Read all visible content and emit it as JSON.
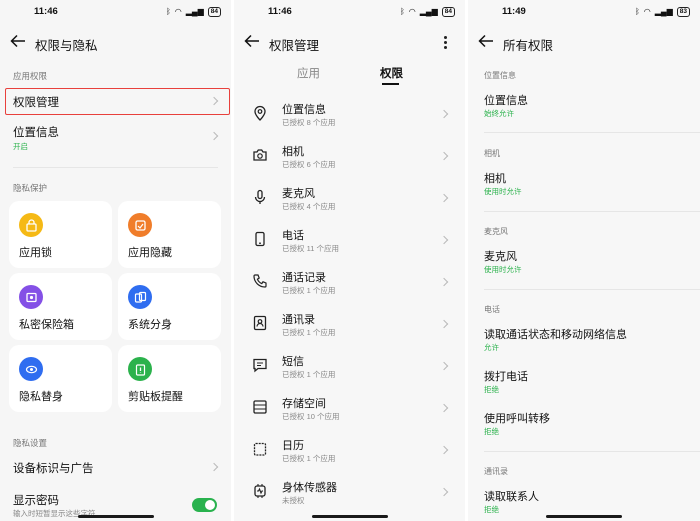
{
  "colors": {
    "accent_green": "#29b24e",
    "highlight_red": "#e8403c",
    "status_on": "#2bb24c"
  },
  "panel1": {
    "time": "11:46",
    "battery": "84",
    "title": "权限与隐私",
    "sec_app": "应用权限",
    "perm_mgmt": "权限管理",
    "location": "位置信息",
    "location_status": "开启",
    "sec_privacy": "隐私保护",
    "cards": [
      {
        "label": "应用锁",
        "icon": "app-lock-icon",
        "color": "#f5b915"
      },
      {
        "label": "应用隐藏",
        "icon": "app-hide-icon",
        "color": "#f07d2a"
      },
      {
        "label": "私密保险箱",
        "icon": "private-safe-icon",
        "color": "#8450e6"
      },
      {
        "label": "系统分身",
        "icon": "system-clone-icon",
        "color": "#2f6df0"
      },
      {
        "label": "隐私替身",
        "icon": "privacy-standin-icon",
        "color": "#2f6df0"
      },
      {
        "label": "剪贴板提醒",
        "icon": "clipboard-alert-icon",
        "color": "#2bb24c"
      }
    ],
    "sec_settings": "隐私设置",
    "device_id": "设备标识与广告",
    "show_password": "显示密码",
    "show_password_sub": "输入时短暂显示这些字符"
  },
  "panel2": {
    "time": "11:46",
    "battery": "84",
    "title": "权限管理",
    "tab_apps": "应用",
    "tab_perms": "权限",
    "items": [
      {
        "title": "位置信息",
        "sub": "已授权 8 个应用",
        "icon": "location-pin-icon"
      },
      {
        "title": "相机",
        "sub": "已授权 6 个应用",
        "icon": "camera-icon"
      },
      {
        "title": "麦克风",
        "sub": "已授权 4 个应用",
        "icon": "microphone-icon"
      },
      {
        "title": "电话",
        "sub": "已授权 11 个应用",
        "icon": "phone-device-icon"
      },
      {
        "title": "通话记录",
        "sub": "已授权 1 个应用",
        "icon": "call-log-icon"
      },
      {
        "title": "通讯录",
        "sub": "已授权 1 个应用",
        "icon": "contacts-icon"
      },
      {
        "title": "短信",
        "sub": "已授权 1 个应用",
        "icon": "sms-icon"
      },
      {
        "title": "存储空间",
        "sub": "已授权 10 个应用",
        "icon": "storage-icon"
      },
      {
        "title": "日历",
        "sub": "已授权 1 个应用",
        "icon": "calendar-icon"
      },
      {
        "title": "身体传感器",
        "sub": "未授权",
        "icon": "body-sensor-icon"
      }
    ]
  },
  "panel3": {
    "time": "11:49",
    "battery": "83",
    "title": "所有权限",
    "sec_location": "位置信息",
    "location": "位置信息",
    "location_status": "始终允许",
    "sec_camera": "相机",
    "camera": "相机",
    "camera_status": "使用时允许",
    "sec_mic": "麦克风",
    "mic": "麦克风",
    "mic_status": "使用时允许",
    "sec_phone": "电话",
    "read_phone": "读取通话状态和移动网络信息",
    "read_phone_status": "允许",
    "dial": "拨打电话",
    "dial_status": "拒绝",
    "forward": "使用呼叫转移",
    "forward_status": "拒绝",
    "sec_contacts": "通讯录",
    "read_contacts": "读取联系人",
    "read_contacts_status": "拒绝"
  }
}
